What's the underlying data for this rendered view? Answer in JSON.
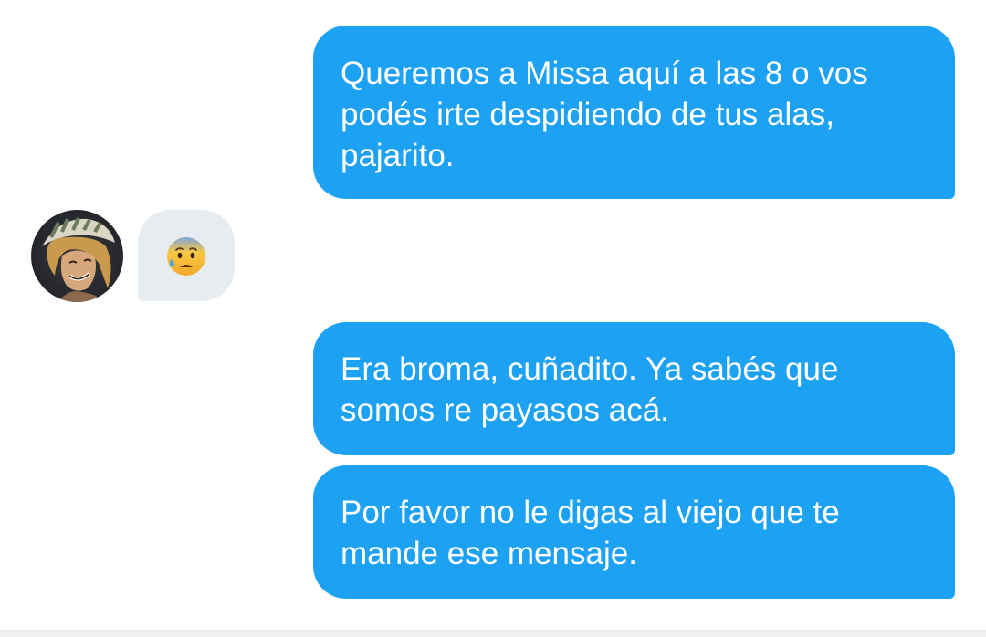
{
  "colors": {
    "outgoing_bubble": "#1da1f2",
    "incoming_bubble": "#e6ecf0",
    "outgoing_text": "#ffffff",
    "background": "#ffffff"
  },
  "messages": [
    {
      "direction": "outgoing",
      "lines": [
        "Queremos a Missa aquí a las 8 o vos",
        "podés irte despidiendo de tus alas,",
        "pajarito."
      ]
    },
    {
      "direction": "incoming",
      "avatar_icon": "user-avatar",
      "emoji_icon": "anxious-face-with-sweat-icon"
    },
    {
      "direction": "outgoing",
      "lines": [
        "Era broma, cuñadito. Ya sabés que",
        "somos re payasos acá."
      ]
    },
    {
      "direction": "outgoing",
      "lines": [
        "Por favor no le digas al viejo que te",
        "mande ese mensaje."
      ]
    }
  ]
}
